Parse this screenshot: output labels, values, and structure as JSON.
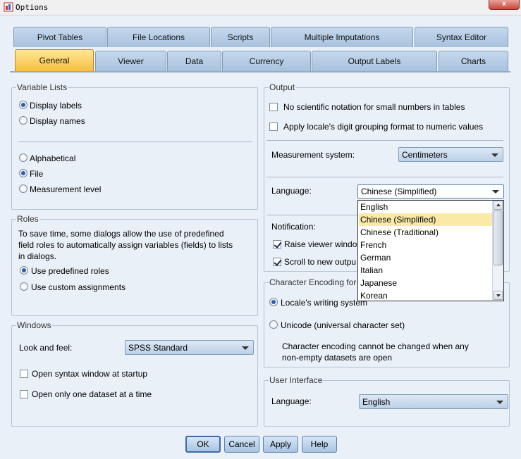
{
  "window": {
    "title": "Options",
    "close_glyph": "x"
  },
  "tabs_row1": [
    "Pivot Tables",
    "File Locations",
    "Scripts",
    "Multiple Imputations",
    "Syntax Editor"
  ],
  "tabs_row2": [
    "General",
    "Viewer",
    "Data",
    "Currency",
    "Output Labels",
    "Charts"
  ],
  "active_tab": "General",
  "variable_lists": {
    "title": "Variable Lists",
    "display_labels": "Display labels",
    "display_names": "Display names",
    "alphabetical": "Alphabetical",
    "file": "File",
    "measurement_level": "Measurement level",
    "selected_display": "Display labels",
    "selected_order": "File"
  },
  "roles": {
    "title": "Roles",
    "description": [
      "To save time, some dialogs allow the use of predefined",
      "field roles to automatically assign variables (fields) to lists",
      "in dialogs."
    ],
    "use_predefined": "Use predefined roles",
    "use_custom": "Use custom assignments",
    "selected": "Use predefined roles"
  },
  "windows": {
    "title": "Windows",
    "look_and_feel_label": "Look and feel:",
    "look_and_feel_value": "SPSS Standard",
    "open_syntax": "Open syntax window at startup",
    "open_one_dataset": "Open only one dataset at a time",
    "open_syntax_checked": false,
    "open_one_dataset_checked": false
  },
  "output": {
    "title": "Output",
    "no_scientific": "No scientific notation for small numbers in tables",
    "apply_grouping": "Apply locale's digit  grouping format to numeric values",
    "no_scientific_checked": false,
    "apply_grouping_checked": false,
    "measurement_label": "Measurement system:",
    "measurement_value": "Centimeters",
    "language_label": "Language:",
    "language_value": "Chinese (Simplified)",
    "language_options": [
      "English",
      "Chinese (Simplified)",
      "Chinese (Traditional)",
      "French",
      "German",
      "Italian",
      "Japanese",
      "Korean"
    ],
    "notification_label": "Notification:",
    "raise_viewer": "Raise viewer windo",
    "scroll_new": "Scroll to new outpu",
    "raise_viewer_checked": true,
    "scroll_new_checked": true
  },
  "char_encoding": {
    "title": "Character Encoding for",
    "locale_writing": "Locale's writing system",
    "unicode": "Unicode (universal character set)",
    "selected": "Locale's writing system",
    "note": [
      "Character encoding cannot be changed when any",
      "non-empty datasets are open"
    ]
  },
  "user_interface": {
    "title": "User Interface",
    "language_label": "Language:",
    "language_value": "English"
  },
  "buttons": {
    "ok": "OK",
    "cancel": "Cancel",
    "apply": "Apply",
    "help": "Help"
  }
}
